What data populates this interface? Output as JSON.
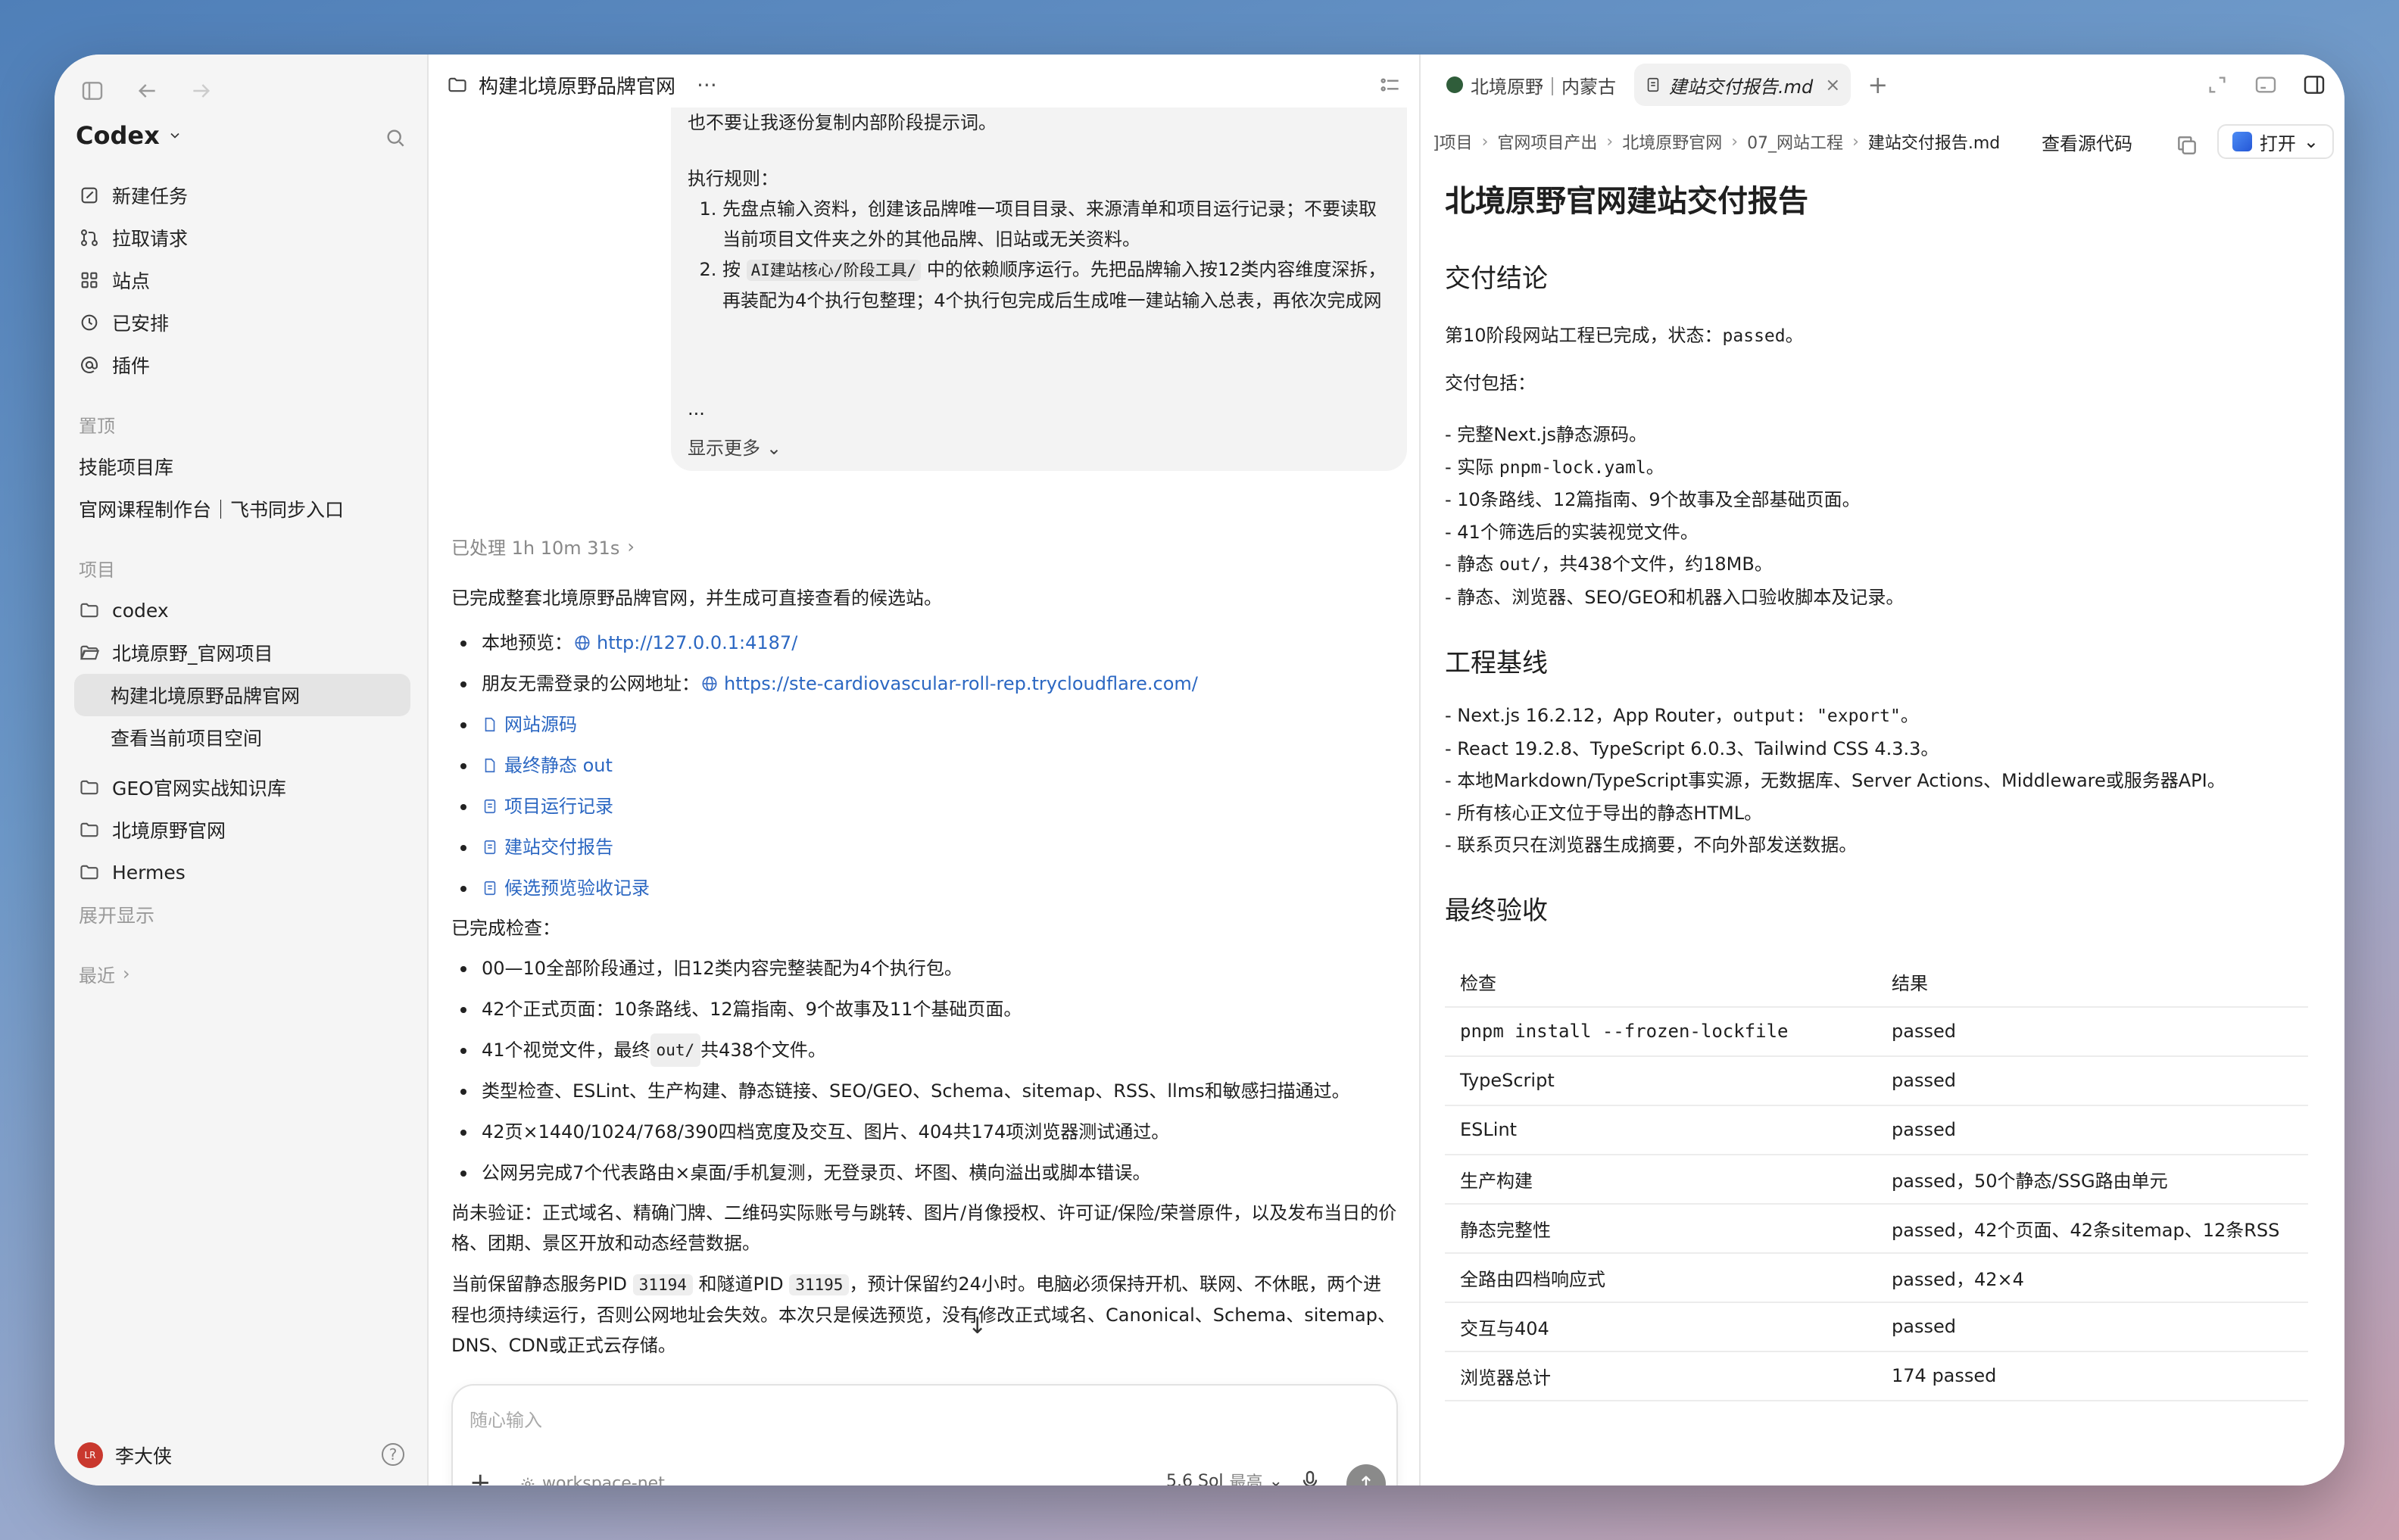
{
  "sidebar": {
    "brand": "Codex",
    "nav": [
      "新建任务",
      "拉取请求",
      "站点",
      "已安排",
      "插件"
    ],
    "pinned_label": "置顶",
    "pinned": [
      "技能项目库",
      "官网课程制作台｜飞书同步入口"
    ],
    "projects_label": "项目",
    "projects": {
      "p1": "codex",
      "p2": "北境原野_官网项目",
      "p2_sub1": "构建北境原野品牌官网",
      "p2_sub2": "查看当前项目空间",
      "p3": "GEO官网实战知识库",
      "p4": "北境原野官网",
      "p5": "Hermes"
    },
    "expand": "展开显示",
    "recent": "最近",
    "user": {
      "name": "李大侠",
      "initials": "LR"
    }
  },
  "chat": {
    "title": "构建北境原野品牌官网",
    "bubble": {
      "line0": "也不要让我逐份复制内部阶段提示词。",
      "rules_title": "执行规则：",
      "rule1": "先盘点输入资料，创建该品牌唯一项目目录、来源清单和项目运行记录；不要读取当前项目文件夹之外的其他品牌、旧站或无关资料。",
      "rule2_pre": "按 ",
      "rule2_code": "AI建站核心/阶段工具/",
      "rule2_post": " 中的依赖顺序运行。先把品牌输入按12类内容维度深拆，再装配为4个执行包整理；4个执行包完成后生成唯一建站输入总表，再依次完成网站策略、页面设计、全站内容、视觉素材和网站工程，不得因为合并执行",
      "ellipsis": "...",
      "show_more": "显示更多"
    },
    "processed": "已处理 1h 10m 31s",
    "intro": "已完成整套北境原野品牌官网，并生成可直接查看的候选站。",
    "links": {
      "local_label": "本地预览：",
      "local_url": "http://127.0.0.1:4187/",
      "public_label": "朋友无需登录的公网地址：",
      "public_url": "https://ste-cardiovascular-roll-rep.trycloudflare.com/",
      "files": [
        "网站源码",
        "最终静态 out",
        "项目运行记录",
        "建站交付报告",
        "候选预览验收记录"
      ]
    },
    "checks_title": "已完成检查：",
    "checks": {
      "c1": "00—10全部阶段通过，旧12类内容完整装配为4个执行包。",
      "c2": "42个正式页面：10条路线、12篇指南、9个故事及11个基础页面。",
      "c3_pre": "41个视觉文件，最终 ",
      "c3_code": "out/",
      "c3_post": " 共438个文件。",
      "c4": "类型检查、ESLint、生产构建、静态链接、SEO/GEO、Schema、sitemap、RSS、llms和敏感扫描通过。",
      "c5": "42页×1440/1024/768/390四档宽度及交互、图片、404共174项浏览器测试通过。",
      "c6": "公网另完成7个代表路由×桌面/手机复测，无登录页、坏图、横向溢出或脚本错误。"
    },
    "pending": "尚未验证：正式域名、精确门牌、二维码实际账号与跳转、图片/肖像授权、许可证/保险/荣誉原件，以及发布当日的价格、团期、景区开放和动态经营数据。",
    "service": {
      "pre": "当前保留静态服务PID ",
      "pid1": "31194",
      "mid": " 和隧道PID ",
      "pid2": "31195",
      "post": "，预计保留约24小时。电脑必须保持开机、联网、不休眠，两个进程也须持续运行，否则公网地址会失效。本次只是候选预览，没有修改正式域名、Canonical、Schema、sitemap、DNS、CDN或正式云存储。"
    },
    "composer": {
      "placeholder": "随心输入",
      "workspace": "workspace-net",
      "model": "5.6 Sol",
      "level": "最高"
    }
  },
  "doc": {
    "tabs": {
      "t1": "北境原野｜内蒙古",
      "t2": "建站交付报告.md"
    },
    "breadcrumbs": [
      "]项目",
      "官网项目产出",
      "北境原野官网",
      "07_网站工程",
      "建站交付报告.md"
    ],
    "view_source": "查看源代码",
    "open": "打开",
    "title": "北境原野官网建站交付报告",
    "s1": {
      "heading": "交付结论",
      "p1_pre": "第10阶段网站工程已完成，状态：",
      "p1_code": "passed",
      "p1_post": "。",
      "p2": "交付包括：",
      "items": {
        "i1": "- 完整Next.js静态源码。",
        "i2_pre": "- 实际 ",
        "i2_code": "pnpm-lock.yaml",
        "i2_post": "。",
        "i3": "- 10条路线、12篇指南、9个故事及全部基础页面。",
        "i4": "- 41个筛选后的实装视觉文件。",
        "i5_pre": "- 静态 ",
        "i5_code": "out/",
        "i5_post": "，共438个文件，约18MB。",
        "i6": "- 静态、浏览器、SEO/GEO和机器入口验收脚本及记录。"
      }
    },
    "s2": {
      "heading": "工程基线",
      "items": {
        "i1_pre": "- Next.js 16.2.12，App Router，",
        "i1_code": "output: \"export\"",
        "i1_post": "。",
        "i2": "- React 19.2.8、TypeScript 6.0.3、Tailwind CSS 4.3.3。",
        "i3": "- 本地Markdown/TypeScript事实源，无数据库、Server Actions、Middleware或服务器API。",
        "i4": "- 所有核心正文位于导出的静态HTML。",
        "i5": "- 联系页只在浏览器生成摘要，不向外部发送数据。"
      }
    },
    "s3": {
      "heading": "最终验收",
      "col1": "检查",
      "col2": "结果",
      "rows": [
        {
          "check": "pnpm install --frozen-lockfile",
          "result": "passed"
        },
        {
          "check": "TypeScript",
          "result": "passed"
        },
        {
          "check": "ESLint",
          "result": "passed"
        },
        {
          "check": "生产构建",
          "result": "passed，50个静态/SSG路由单元"
        },
        {
          "check": "静态完整性",
          "result": "passed，42个页面、42条sitemap、12条RSS"
        },
        {
          "check": "全路由四档响应式",
          "result": "passed，42×4"
        },
        {
          "check": "交互与404",
          "result": "passed"
        },
        {
          "check": "浏览器总计",
          "result": "174 passed"
        }
      ]
    }
  }
}
